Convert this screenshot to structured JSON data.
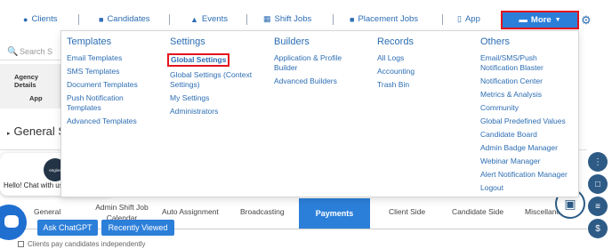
{
  "topnav": {
    "items": [
      {
        "label": "Clients",
        "icon": "globe-icon"
      },
      {
        "label": "Candidates",
        "icon": "briefcase-icon"
      },
      {
        "label": "Events",
        "icon": "trophy-icon"
      },
      {
        "label": "Shift Jobs",
        "icon": "calendar-icon"
      },
      {
        "label": "Placement Jobs",
        "icon": "suitcase-icon"
      },
      {
        "label": "App",
        "icon": "mobile-icon"
      }
    ],
    "more_label": "More",
    "more_icon": "chat-icon",
    "settings_icon": "gear-icon"
  },
  "mega_menu": {
    "templates": {
      "title": "Templates",
      "items": [
        "Email Templates",
        "SMS Templates",
        "Document Templates",
        "Push Notification Templates",
        "Advanced Templates"
      ]
    },
    "settings": {
      "title": "Settings",
      "items": [
        "Global Settings",
        "Global Settings (Context Settings)",
        "My Settings",
        "Administrators"
      ]
    },
    "builders": {
      "title": "Builders",
      "items": [
        "Application & Profile Builder",
        "Advanced Builders"
      ]
    },
    "records": {
      "title": "Records",
      "items": [
        "All Logs",
        "Accounting",
        "Trash Bin"
      ]
    },
    "others": {
      "title": "Others",
      "items": [
        "Email/SMS/Push Notification Blaster",
        "Notification Center",
        "Metrics & Analysis",
        "Community",
        "Global Predefined Values",
        "Candidate Board",
        "Admin Badge Manager",
        "Webinar Manager",
        "Alert Notification Manager",
        "Logout"
      ]
    }
  },
  "page": {
    "search_placeholder": "Search S",
    "side_agency": "Agency Details",
    "side_app": "App",
    "section_title": "General S",
    "section_arrow": "▸",
    "tabs": [
      "General",
      "Admin Shift Job Calendar",
      "Auto Assignment",
      "Broadcasting",
      "Payments",
      "Client Side",
      "Candidate Side",
      "Miscellaneous"
    ],
    "active_tab": "Payments",
    "ask_chatgpt": "Ask ChatGPT",
    "recently_viewed": "Recently Viewed",
    "bottom_text": "Clients pay candidates independently"
  },
  "chat": {
    "greeting": "Hello! Chat with us!",
    "logo_text": "engine",
    "close": "✕"
  },
  "colors": {
    "primary": "#2c7fd9",
    "link": "#2c6db3",
    "highlight_border": "#e3141d",
    "fab": "#2d5b86"
  }
}
